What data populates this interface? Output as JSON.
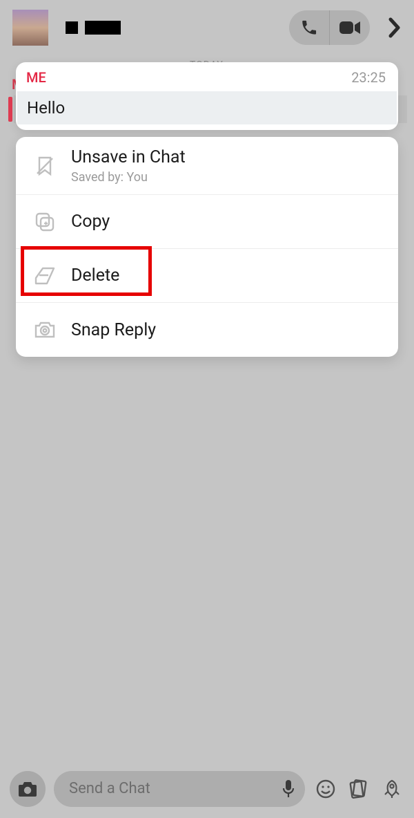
{
  "chat": {
    "today_label": "TODAY",
    "bg_sender": "M"
  },
  "message": {
    "sender": "ME",
    "time": "23:25",
    "body": "Hello"
  },
  "menu": {
    "unsave": {
      "label": "Unsave in Chat",
      "sub": "Saved by: You"
    },
    "copy": {
      "label": "Copy"
    },
    "delete": {
      "label": "Delete"
    },
    "snap_reply": {
      "label": "Snap Reply"
    }
  },
  "composer": {
    "placeholder": "Send a Chat"
  }
}
